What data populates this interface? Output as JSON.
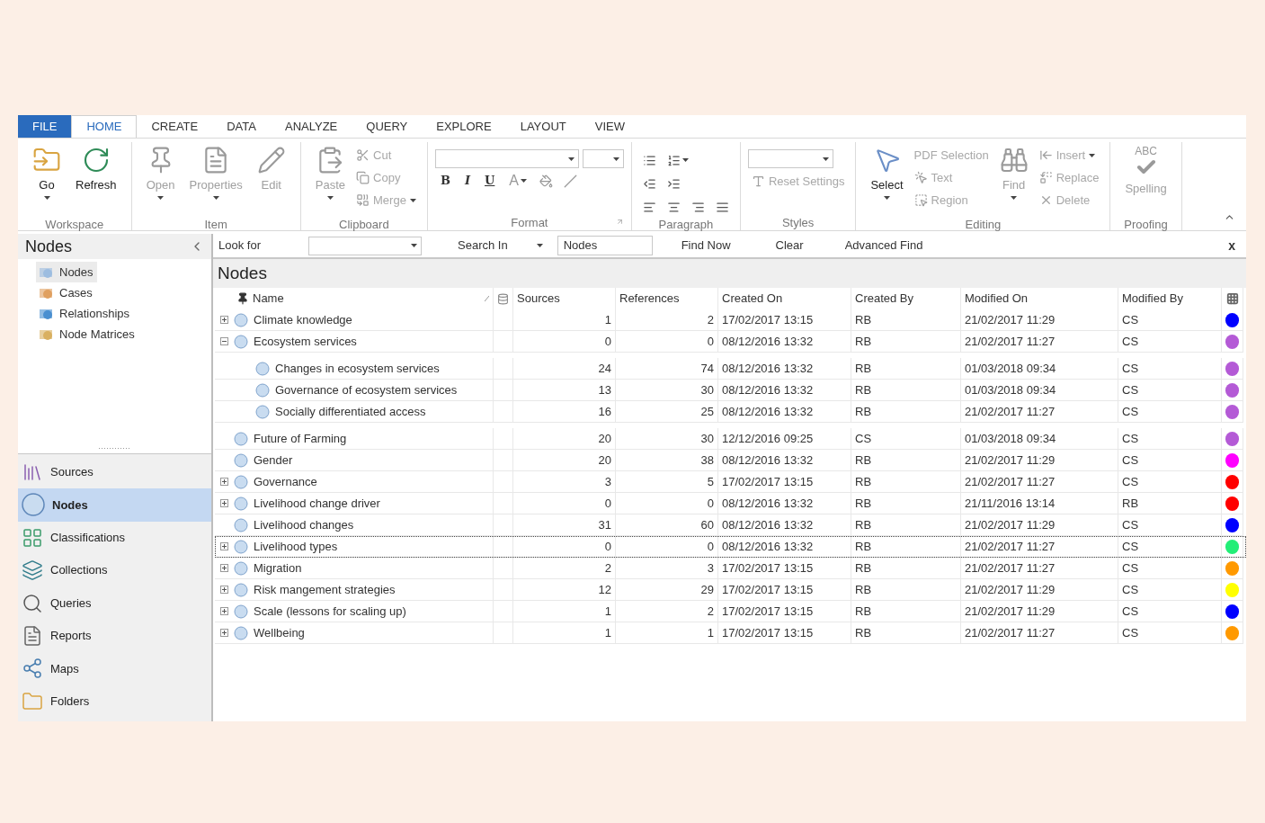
{
  "ribbon_tabs": [
    {
      "label": "FILE",
      "kind": "file",
      "selected": false
    },
    {
      "label": "HOME",
      "kind": "tab",
      "selected": true
    },
    {
      "label": "CREATE",
      "kind": "tab",
      "selected": false
    },
    {
      "label": "DATA",
      "kind": "tab",
      "selected": false
    },
    {
      "label": "ANALYZE",
      "kind": "tab",
      "selected": false
    },
    {
      "label": "QUERY",
      "kind": "tab",
      "selected": false
    },
    {
      "label": "EXPLORE",
      "kind": "tab",
      "selected": false
    },
    {
      "label": "LAYOUT",
      "kind": "tab",
      "selected": false
    },
    {
      "label": "VIEW",
      "kind": "tab",
      "selected": false
    }
  ],
  "ribbon_groups": [
    {
      "label": "Workspace",
      "items": [
        {
          "kind": "large",
          "label": "Go",
          "dropdown": true,
          "disabled": false
        },
        {
          "kind": "large",
          "label": "Refresh",
          "dropdown": false,
          "disabled": false
        }
      ]
    },
    {
      "label": "Item",
      "items": [
        {
          "kind": "large",
          "label": "Open",
          "dropdown": true,
          "disabled": true
        },
        {
          "kind": "large",
          "label": "Properties",
          "dropdown": true,
          "disabled": true
        },
        {
          "kind": "large",
          "label": "Edit",
          "dropdown": false,
          "disabled": true
        }
      ]
    },
    {
      "label": "Clipboard",
      "items": [
        {
          "kind": "large",
          "label": "Paste",
          "dropdown": true,
          "disabled": true
        },
        {
          "kind": "small",
          "label": "Cut",
          "dropdown": false,
          "disabled": true
        },
        {
          "kind": "small",
          "label": "Copy",
          "dropdown": false,
          "disabled": true
        },
        {
          "kind": "small",
          "label": "Merge",
          "dropdown": true,
          "disabled": true
        }
      ]
    },
    {
      "label": "Format",
      "launcher": true,
      "rows": [
        [
          {
            "kind": "combo"
          },
          {
            "kind": "combo"
          }
        ],
        [
          {
            "kind": "glyph",
            "label": "B",
            "dropdown": false,
            "disabled": false
          },
          {
            "kind": "glyph",
            "label": "I",
            "dropdown": false,
            "disabled": false
          },
          {
            "kind": "glyph",
            "label": "U",
            "dropdown": false,
            "disabled": false
          },
          {
            "kind": "glyph",
            "label": "A",
            "dropdown": true,
            "disabled": true
          },
          {
            "kind": "icon",
            "dropdown": false,
            "disabled": true
          },
          {
            "kind": "icon",
            "dropdown": false,
            "disabled": true
          }
        ]
      ]
    },
    {
      "label": "Paragraph",
      "launcher": false,
      "rows": [
        [
          {
            "kind": "icon",
            "dropdown": false,
            "disabled": false
          },
          {
            "kind": "icon",
            "dropdown": true,
            "disabled": false
          }
        ],
        [
          {
            "kind": "icon",
            "dropdown": false,
            "disabled": false
          },
          {
            "kind": "icon",
            "dropdown": false,
            "disabled": false
          }
        ],
        [
          {
            "kind": "icon",
            "dropdown": false,
            "disabled": false
          },
          {
            "kind": "icon",
            "dropdown": false,
            "disabled": false
          },
          {
            "kind": "icon",
            "dropdown": false,
            "disabled": false
          },
          {
            "kind": "icon",
            "dropdown": false,
            "disabled": false
          }
        ]
      ]
    },
    {
      "label": "Styles",
      "launcher": false,
      "rows": [
        [
          {
            "kind": "combo"
          }
        ],
        [
          {
            "kind": "small",
            "label": "Reset Settings",
            "dropdown": false,
            "disabled": true
          }
        ]
      ]
    },
    {
      "label": "Editing",
      "items": [
        {
          "kind": "large",
          "label": "Select",
          "dropdown": true,
          "disabled": false
        },
        {
          "kind": "text",
          "label": "PDF Selection",
          "dropdown": false,
          "disabled": true
        },
        {
          "kind": "small",
          "label": "Text",
          "dropdown": false,
          "disabled": true
        },
        {
          "kind": "small",
          "label": "Region",
          "dropdown": false,
          "disabled": true
        },
        {
          "kind": "large",
          "label": "Find",
          "dropdown": true,
          "disabled": true
        },
        {
          "kind": "small",
          "label": "Insert",
          "dropdown": true,
          "disabled": true
        },
        {
          "kind": "small",
          "label": "Replace",
          "dropdown": false,
          "disabled": true
        },
        {
          "kind": "small",
          "label": "Delete",
          "dropdown": false,
          "disabled": true
        }
      ]
    },
    {
      "label": "Proofing",
      "items": [
        {
          "kind": "large",
          "label": "Spelling",
          "caption": "ABC",
          "dropdown": false,
          "disabled": true
        }
      ]
    }
  ],
  "navigation": {
    "title": "Nodes",
    "tree": [
      {
        "label": "Nodes",
        "selected": true
      },
      {
        "label": "Cases",
        "selected": false
      },
      {
        "label": "Relationships",
        "selected": false
      },
      {
        "label": "Node Matrices",
        "selected": false
      }
    ],
    "buttons": [
      {
        "label": "Sources",
        "selected": false
      },
      {
        "label": "Nodes",
        "selected": true
      },
      {
        "label": "Classifications",
        "selected": false
      },
      {
        "label": "Collections",
        "selected": false
      },
      {
        "label": "Queries",
        "selected": false
      },
      {
        "label": "Reports",
        "selected": false
      },
      {
        "label": "Maps",
        "selected": false
      },
      {
        "label": "Folders",
        "selected": false
      }
    ]
  },
  "find_bar": {
    "look_for_label": "Look for",
    "search_in_label": "Search In",
    "search_in_value": "Nodes",
    "buttons": [
      "Find Now",
      "Clear",
      "Advanced Find"
    ],
    "close": "x"
  },
  "list": {
    "title": "Nodes",
    "columns": [
      "Name",
      "Sources",
      "References",
      "Created On",
      "Created By",
      "Modified On",
      "Modified By"
    ],
    "rows": [
      {
        "kind": "parent",
        "expanded": false,
        "focused": false,
        "name": "Climate knowledge",
        "sources": "1",
        "references": "2",
        "created_on": "17/02/2017 13:15",
        "created_by": "RB",
        "modified_on": "21/02/2017 11:29",
        "modified_by": "CS",
        "color": "#0000ff"
      },
      {
        "kind": "parent",
        "expanded": true,
        "focused": false,
        "name": "Ecosystem services",
        "sources": "0",
        "references": "0",
        "created_on": "08/12/2016 13:32",
        "created_by": "RB",
        "modified_on": "21/02/2017 11:27",
        "modified_by": "CS",
        "color": "#b45ad6",
        "children": [
          {
            "focused": false,
            "name": "Changes in ecosystem services",
            "sources": "24",
            "references": "74",
            "created_on": "08/12/2016 13:32",
            "created_by": "RB",
            "modified_on": "01/03/2018 09:34",
            "modified_by": "CS",
            "color": "#b45ad6"
          },
          {
            "focused": false,
            "name": "Governance of ecosystem services",
            "sources": "13",
            "references": "30",
            "created_on": "08/12/2016 13:32",
            "created_by": "RB",
            "modified_on": "01/03/2018 09:34",
            "modified_by": "CS",
            "color": "#b45ad6"
          },
          {
            "focused": false,
            "name": "Socially differentiated access",
            "sources": "16",
            "references": "25",
            "created_on": "08/12/2016 13:32",
            "created_by": "RB",
            "modified_on": "21/02/2017 11:27",
            "modified_by": "CS",
            "color": "#b45ad6"
          }
        ]
      },
      {
        "kind": "leaf",
        "focused": false,
        "name": "Future of Farming",
        "sources": "20",
        "references": "30",
        "created_on": "12/12/2016 09:25",
        "created_by": "CS",
        "modified_on": "01/03/2018 09:34",
        "modified_by": "CS",
        "color": "#b45ad6"
      },
      {
        "kind": "leaf",
        "focused": false,
        "name": "Gender",
        "sources": "20",
        "references": "38",
        "created_on": "08/12/2016 13:32",
        "created_by": "RB",
        "modified_on": "21/02/2017 11:29",
        "modified_by": "CS",
        "color": "#ff00ff"
      },
      {
        "kind": "parent",
        "expanded": false,
        "focused": false,
        "name": "Governance",
        "sources": "3",
        "references": "5",
        "created_on": "17/02/2017 13:15",
        "created_by": "RB",
        "modified_on": "21/02/2017 11:27",
        "modified_by": "CS",
        "color": "#ff0000"
      },
      {
        "kind": "parent",
        "expanded": false,
        "focused": false,
        "name": "Livelihood change driver",
        "sources": "0",
        "references": "0",
        "created_on": "08/12/2016 13:32",
        "created_by": "RB",
        "modified_on": "21/11/2016 13:14",
        "modified_by": "RB",
        "color": "#ff0000"
      },
      {
        "kind": "leaf",
        "focused": false,
        "name": "Livelihood changes",
        "sources": "31",
        "references": "60",
        "created_on": "08/12/2016 13:32",
        "created_by": "RB",
        "modified_on": "21/02/2017 11:29",
        "modified_by": "CS",
        "color": "#0000ff"
      },
      {
        "kind": "parent",
        "expanded": false,
        "focused": true,
        "name": "Livelihood types",
        "sources": "0",
        "references": "0",
        "created_on": "08/12/2016 13:32",
        "created_by": "RB",
        "modified_on": "21/02/2017 11:27",
        "modified_by": "CS",
        "color": "#22ee77"
      },
      {
        "kind": "parent",
        "expanded": false,
        "focused": false,
        "name": "Migration",
        "sources": "2",
        "references": "3",
        "created_on": "17/02/2017 13:15",
        "created_by": "RB",
        "modified_on": "21/02/2017 11:27",
        "modified_by": "CS",
        "color": "#ff9900"
      },
      {
        "kind": "parent",
        "expanded": false,
        "focused": false,
        "name": "Risk mangement strategies",
        "sources": "12",
        "references": "29",
        "created_on": "17/02/2017 13:15",
        "created_by": "RB",
        "modified_on": "21/02/2017 11:29",
        "modified_by": "CS",
        "color": "#ffff00"
      },
      {
        "kind": "parent",
        "expanded": false,
        "focused": false,
        "name": "Scale (lessons for scaling up)",
        "sources": "1",
        "references": "2",
        "created_on": "17/02/2017 13:15",
        "created_by": "RB",
        "modified_on": "21/02/2017 11:29",
        "modified_by": "CS",
        "color": "#0000ff"
      },
      {
        "kind": "parent",
        "expanded": false,
        "focused": false,
        "name": "Wellbeing",
        "sources": "1",
        "references": "1",
        "created_on": "17/02/2017 13:15",
        "created_by": "RB",
        "modified_on": "21/02/2017 11:27",
        "modified_by": "CS",
        "color": "#ff9900"
      }
    ]
  }
}
